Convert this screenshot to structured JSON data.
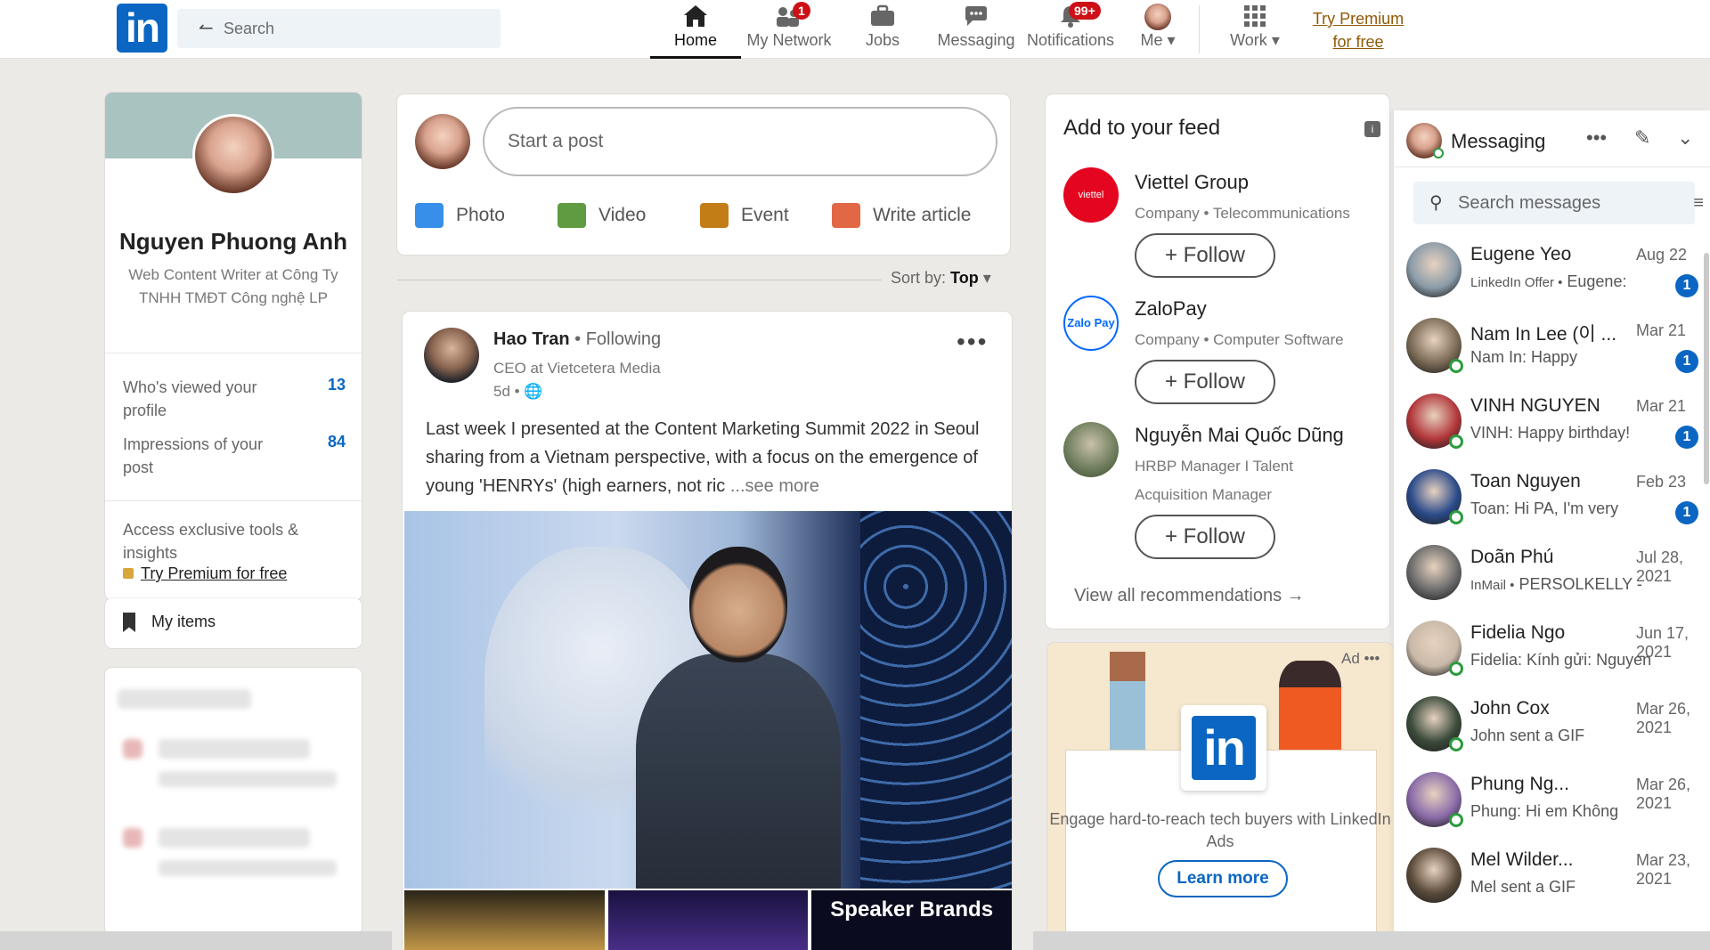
{
  "header": {
    "logo": "in",
    "search_placeholder": "Search",
    "nav": [
      {
        "label": "Home",
        "icon": "home-icon"
      },
      {
        "label": "My Network",
        "icon": "network-icon",
        "badge": "1"
      },
      {
        "label": "Jobs",
        "icon": "briefcase-icon"
      },
      {
        "label": "Messaging",
        "icon": "chat-icon"
      },
      {
        "label": "Notifications",
        "icon": "bell-icon",
        "badge": "99+"
      },
      {
        "label": "Me",
        "icon": "avatar-icon"
      },
      {
        "label": "Work",
        "icon": "grid-icon"
      }
    ],
    "premium_line1": "Try Premium",
    "premium_line2": "for free"
  },
  "profile": {
    "name": "Nguyen Phuong Anh",
    "title": "Web Content Writer at Công Ty TNHH TMĐT Công nghệ LP",
    "stats": [
      {
        "label": "Who's viewed your profile",
        "value": "13"
      },
      {
        "label": "Impressions of your post",
        "value": "84"
      }
    ],
    "premium_text": "Access exclusive tools & insights",
    "premium_link": "Try Premium for free",
    "my_items": "My items"
  },
  "composer": {
    "placeholder": "Start a post",
    "actions": [
      {
        "label": "Photo",
        "icon": "photo-icon",
        "color": "#378fe9"
      },
      {
        "label": "Video",
        "icon": "video-icon",
        "color": "#5f9b41"
      },
      {
        "label": "Event",
        "icon": "event-icon",
        "color": "#c37d16"
      },
      {
        "label": "Write article",
        "icon": "article-icon",
        "color": "#e16745"
      }
    ]
  },
  "sort": {
    "label": "Sort by:",
    "value": "Top"
  },
  "post": {
    "author": "Hao Tran",
    "relation": "• Following",
    "headline": "CEO at Vietcetera Media",
    "time": "5d •",
    "text": "Last week I presented at the Content Marketing Summit 2022 in Seoul sharing from a Vietnam perspective, with a focus on the emergence of young 'HENRYs' (high earners, not ric",
    "see_more": "...see more",
    "thumb_caption": "Speaker Brands"
  },
  "feed": {
    "title": "Add to your feed",
    "items": [
      {
        "name": "Viettel Group",
        "sub": "Company • Telecommunications",
        "logo_text": "viettel",
        "color": "#e40520"
      },
      {
        "name": "ZaloPay",
        "sub": "Company • Computer Software",
        "logo_text": "Zalo Pay",
        "color": "#0068ff"
      },
      {
        "name": "Nguyễn Mai Quốc Dũng",
        "sub": "HRBP Manager I Talent Acquisition Manager",
        "logo_text": "",
        "color": "#6b7a5a"
      }
    ],
    "follow_label": "+ Follow",
    "view_all": "View all recommendations →"
  },
  "ad": {
    "label": "Ad",
    "logo": "in",
    "text": "Engage hard-to-reach tech buyers with LinkedIn Ads",
    "button": "Learn more"
  },
  "messaging": {
    "title": "Messaging",
    "search_placeholder": "Search messages",
    "conversations": [
      {
        "name": "Eugene Yeo",
        "date": "Aug 22",
        "tag": "LinkedIn Offer •",
        "msg": "Eugene:",
        "unread": "1",
        "online": false,
        "color": "#8a9ba8"
      },
      {
        "name": "Nam In Lee (이 ...",
        "date": "Mar 21",
        "tag": "",
        "msg": "Nam In: Happy",
        "unread": "1",
        "online": true,
        "color": "#7a6a55"
      },
      {
        "name": "VINH NGUYEN",
        "date": "Mar 21",
        "tag": "",
        "msg": "VINH: Happy birthday!",
        "unread": "1",
        "online": true,
        "color": "#b2363a"
      },
      {
        "name": "Toan Nguyen",
        "date": "Feb 23",
        "tag": "",
        "msg": "Toan: Hi PA, I'm very",
        "unread": "1",
        "online": true,
        "color": "#2a4a8a"
      },
      {
        "name": "Doãn Phú",
        "date": "Jul 28, 2021",
        "tag": "InMail •",
        "msg": "PERSOLKELLY -",
        "unread": "",
        "online": false,
        "color": "#6b6b6b"
      },
      {
        "name": "Fidelia Ngo",
        "date": "Jun 17, 2021",
        "tag": "",
        "msg": "Fidelia: Kính gửi: Nguyen",
        "unread": "",
        "online": true,
        "color": "#c9b9a8"
      },
      {
        "name": "John Cox",
        "date": "Mar 26, 2021",
        "tag": "",
        "msg": "John sent a GIF",
        "unread": "",
        "online": true,
        "color": "#3a4a3a"
      },
      {
        "name": "Phung Ng...",
        "date": "Mar 26, 2021",
        "tag": "",
        "msg": "Phung: Hi em Không",
        "unread": "",
        "online": true,
        "color": "#8a6aa8"
      },
      {
        "name": "Mel Wilder...",
        "date": "Mar 23, 2021",
        "tag": "",
        "msg": "Mel sent a GIF",
        "unread": "",
        "online": false,
        "color": "#5a4a3a"
      }
    ]
  }
}
